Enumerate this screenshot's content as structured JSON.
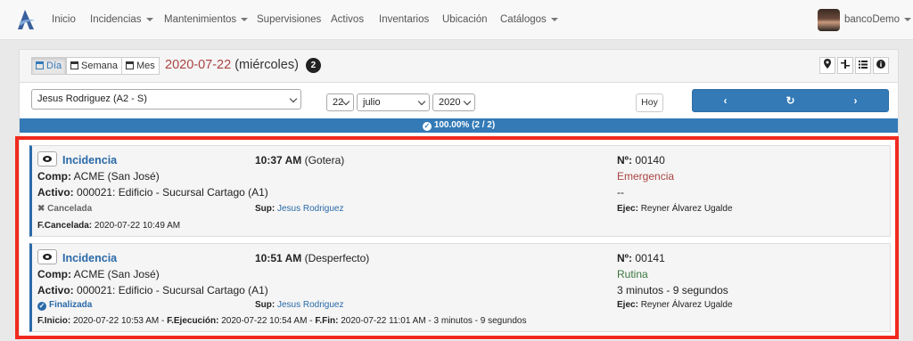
{
  "nav": {
    "items": [
      {
        "label": "Inicio",
        "dropdown": false
      },
      {
        "label": "Incidencias",
        "dropdown": true
      },
      {
        "label": "Mantenimientos",
        "dropdown": true
      },
      {
        "label": "Supervisiones",
        "dropdown": false
      },
      {
        "label": "Activos",
        "dropdown": false
      },
      {
        "label": "Inventarios",
        "dropdown": false
      },
      {
        "label": "Ubicación",
        "dropdown": false
      },
      {
        "label": "Catálogos",
        "dropdown": true
      }
    ],
    "user": "bancoDemo"
  },
  "toolbar": {
    "view_day": "Día",
    "view_week": "Semana",
    "view_month": "Mes",
    "date": "2020-07-22",
    "weekday": "(miércoles)",
    "count": "2",
    "tools": [
      "map-marker-icon",
      "sitemap-icon",
      "list-icon",
      "info-icon"
    ]
  },
  "filters": {
    "person": "Jesus Rodriguez (A2 - S)",
    "day": "22",
    "month": "julio",
    "year": "2020",
    "today_label": "Hoy"
  },
  "progress": {
    "text": "100.00% (2 / 2)",
    "fraction": 1.0
  },
  "colors": {
    "primary": "#337ab7",
    "highlight": "#f02a1e",
    "emergency": "#a94442",
    "routine": "#3c763d"
  },
  "cards": [
    {
      "title": "Incidencia",
      "time": "10:37 AM",
      "type": "(Gotera)",
      "number_label": "Nº:",
      "number": "00140",
      "comp_label": "Comp:",
      "comp": "ACME (San José)",
      "priority": "Emergencia",
      "asset_label": "Activo:",
      "asset": "000021: Edificio - Sucursal Cartago (A1)",
      "duration": "--",
      "status": "Cancelada",
      "sup_label": "Sup:",
      "sup": "Jesus Rodriguez",
      "exec_label": "Ejec:",
      "exec": "Reyner Álvarez Ugalde",
      "footer": [
        {
          "label": "F.Cancelada:",
          "value": "2020-07-22 10:49 AM"
        }
      ]
    },
    {
      "title": "Incidencia",
      "time": "10:51 AM",
      "type": "(Desperfecto)",
      "number_label": "Nº:",
      "number": "00141",
      "comp_label": "Comp:",
      "comp": "ACME (San José)",
      "priority": "Rutina",
      "asset_label": "Activo:",
      "asset": "000021: Edificio - Sucursal Cartago (A1)",
      "duration": "3 minutos - 9 segundos",
      "status": "Finalizada",
      "sup_label": "Sup:",
      "sup": "Jesus Rodriguez",
      "exec_label": "Ejec:",
      "exec": "Reyner Álvarez Ugalde",
      "footer": [
        {
          "label": "F.Inicio:",
          "value": "2020-07-22 10:53 AM - "
        },
        {
          "label": "F.Ejecución:",
          "value": "2020-07-22 10:54 AM - "
        },
        {
          "label": "F.Fin:",
          "value": "2020-07-22 11:01 AM - 3 minutos - 9 segundos"
        }
      ]
    }
  ]
}
